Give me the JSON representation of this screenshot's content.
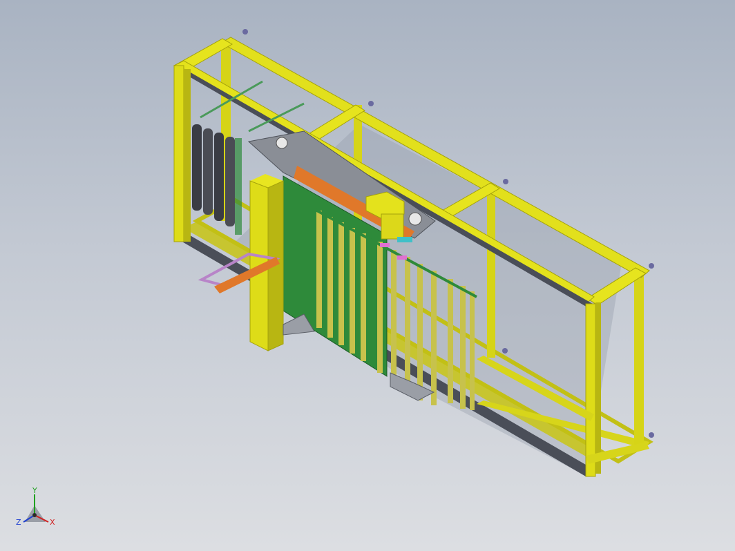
{
  "viewport": {
    "background_top": "#a9b3c2",
    "background_bottom": "#dcdee2"
  },
  "model": {
    "frame_color": "#e0de16",
    "frame_shadow": "#a4a20c",
    "rail_color": "#4a4e58",
    "pcb_color": "#2e8a3a",
    "rod_color": "#c7c24c",
    "roller_color": "#3a3c44",
    "orange_part": "#e0782a",
    "purple_part": "#b884c8"
  },
  "triad": {
    "x_label": "X",
    "y_label": "Y",
    "z_label": "Z",
    "x_color": "#d02020",
    "y_color": "#20a020",
    "z_color": "#2040d0"
  }
}
